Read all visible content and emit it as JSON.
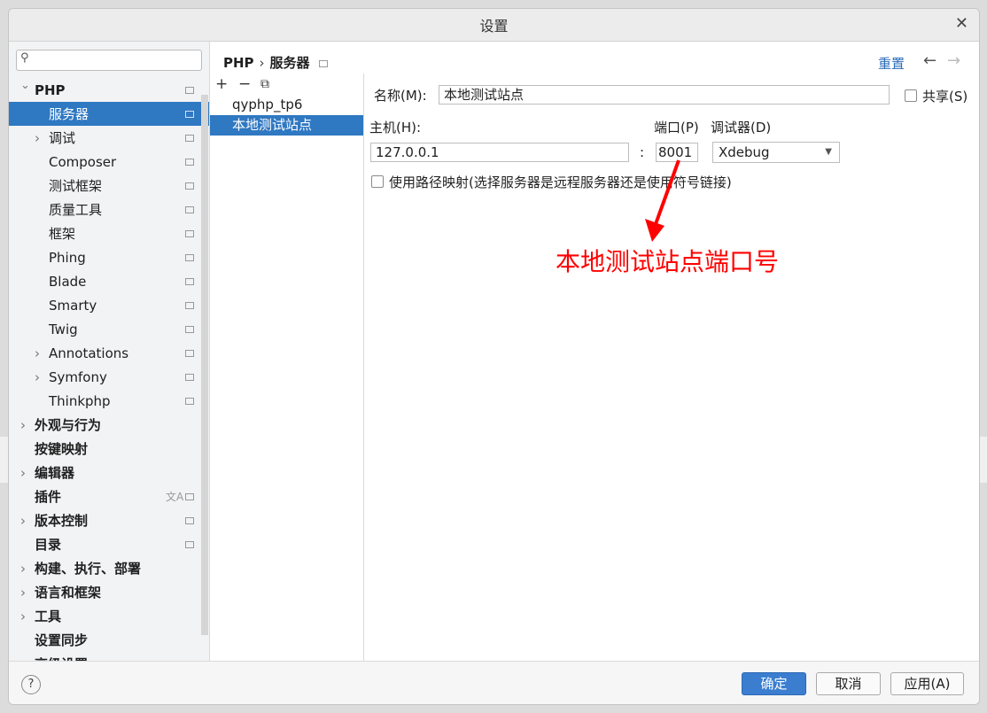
{
  "window": {
    "title": "设置"
  },
  "sidebar": {
    "search_placeholder": "",
    "items": [
      {
        "label": "PHP",
        "bold": true,
        "chevron": "down"
      },
      {
        "label": "服务器",
        "selected": true
      },
      {
        "label": "调试",
        "chevron": "right"
      },
      {
        "label": "Composer"
      },
      {
        "label": "测试框架"
      },
      {
        "label": "质量工具"
      },
      {
        "label": "框架"
      },
      {
        "label": "Phing"
      },
      {
        "label": "Blade"
      },
      {
        "label": "Smarty"
      },
      {
        "label": "Twig"
      },
      {
        "label": "Annotations",
        "chevron": "right"
      },
      {
        "label": "Symfony",
        "chevron": "right"
      },
      {
        "label": "Thinkphp"
      },
      {
        "label": "外观与行为",
        "bold": true,
        "chevron": "right"
      },
      {
        "label": "按键映射",
        "bold": true
      },
      {
        "label": "编辑器",
        "bold": true,
        "chevron": "right"
      },
      {
        "label": "插件",
        "bold": true
      },
      {
        "label": "版本控制",
        "bold": true,
        "chevron": "right"
      },
      {
        "label": "目录",
        "bold": true
      },
      {
        "label": "构建、执行、部署",
        "bold": true,
        "chevron": "right"
      },
      {
        "label": "语言和框架",
        "bold": true,
        "chevron": "right"
      },
      {
        "label": "工具",
        "bold": true,
        "chevron": "right"
      },
      {
        "label": "设置同步",
        "bold": true
      },
      {
        "label": "高级设置",
        "bold": true
      }
    ]
  },
  "header": {
    "crumb1": "PHP",
    "crumb2": "服务器",
    "reset": "重置"
  },
  "servers": [
    "qyphp_tp6",
    "本地测试站点"
  ],
  "form": {
    "name_label": "名称(M):",
    "name_value": "本地测试站点",
    "share_label": "共享(S)",
    "host_label": "主机(H):",
    "host_value": "127.0.0.1",
    "colon": ":",
    "port_label": "端口(P)",
    "port_value": "8001",
    "debugger_label": "调试器(D)",
    "debugger_value": "Xdebug",
    "path_mapping_label": "使用路径映射(选择服务器是远程服务器还是使用符号链接)"
  },
  "annotation": {
    "text": "本地测试站点端口号",
    "color": "#ff0000"
  },
  "footer": {
    "help": "?",
    "ok": "确定",
    "cancel": "取消",
    "apply": "应用(A)"
  },
  "colors": {
    "accent": "#2f78c2",
    "link": "#2b6cb8"
  }
}
